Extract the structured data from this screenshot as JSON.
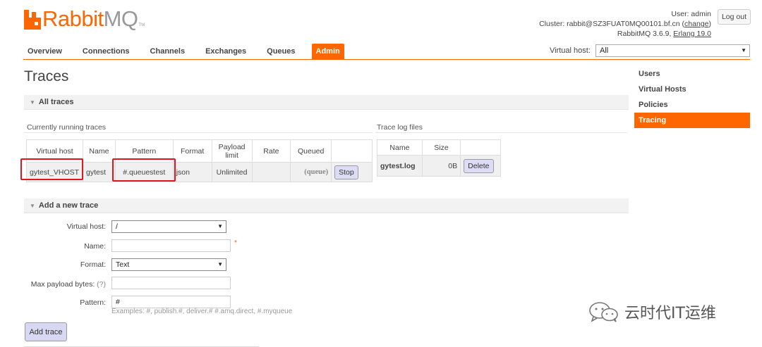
{
  "logo": {
    "text_a": "Rabbit",
    "text_b": "MQ",
    "tm": "TM"
  },
  "header": {
    "user_line": "User: admin",
    "cluster_prefix": "Cluster: rabbit@SZ3FUAT0MQ00101.bf.cn (",
    "cluster_link": "change",
    "cluster_suffix": ")",
    "version_prefix": "RabbitMQ 3.6.9, ",
    "erlang": "Erlang 19.0",
    "logout": "Log out"
  },
  "nav": {
    "tabs": [
      "Overview",
      "Connections",
      "Channels",
      "Exchanges",
      "Queues",
      "Admin"
    ],
    "active": "Admin",
    "vhost_label": "Virtual host:",
    "vhost_value": "All"
  },
  "sidebar": {
    "items": [
      "Users",
      "Virtual Hosts",
      "Policies",
      "Tracing"
    ],
    "active": "Tracing"
  },
  "page_title": "Traces",
  "all_traces": {
    "heading": "All traces",
    "running_caption": "Currently running traces",
    "columns": [
      "Virtual host",
      "Name",
      "Pattern",
      "Format",
      "Payload limit",
      "Rate",
      "Queued"
    ],
    "row": {
      "vhost": "gytest_VHOST",
      "name": "gytest",
      "pattern": "#.queuestest",
      "format": "json",
      "payload": "Unlimited",
      "rate": "",
      "queued": "(queue)",
      "action": "Stop"
    },
    "log_caption": "Trace log files",
    "log_columns": [
      "Name",
      "Size"
    ],
    "log_row": {
      "name": "gytest.log",
      "size": "0B",
      "action": "Delete"
    }
  },
  "add_trace": {
    "heading": "Add a new trace",
    "vhost_label": "Virtual host:",
    "vhost_value": "/",
    "name_label": "Name:",
    "name_value": "",
    "required_mark": "*",
    "format_label": "Format:",
    "format_value": "Text",
    "max_payload_label": "Max payload bytes:",
    "help_mark": "(?)",
    "max_payload_value": "",
    "pattern_label": "Pattern:",
    "pattern_value": "#",
    "pattern_hint": "Examples: #, publish.#, deliver.# #.amq.direct, #.myqueue",
    "submit": "Add trace"
  },
  "watermark": {
    "text": "云时代IT运维"
  },
  "colors": {
    "accent": "#ff6600",
    "highlight": "#e0161e",
    "button": "#dcdcf4"
  }
}
